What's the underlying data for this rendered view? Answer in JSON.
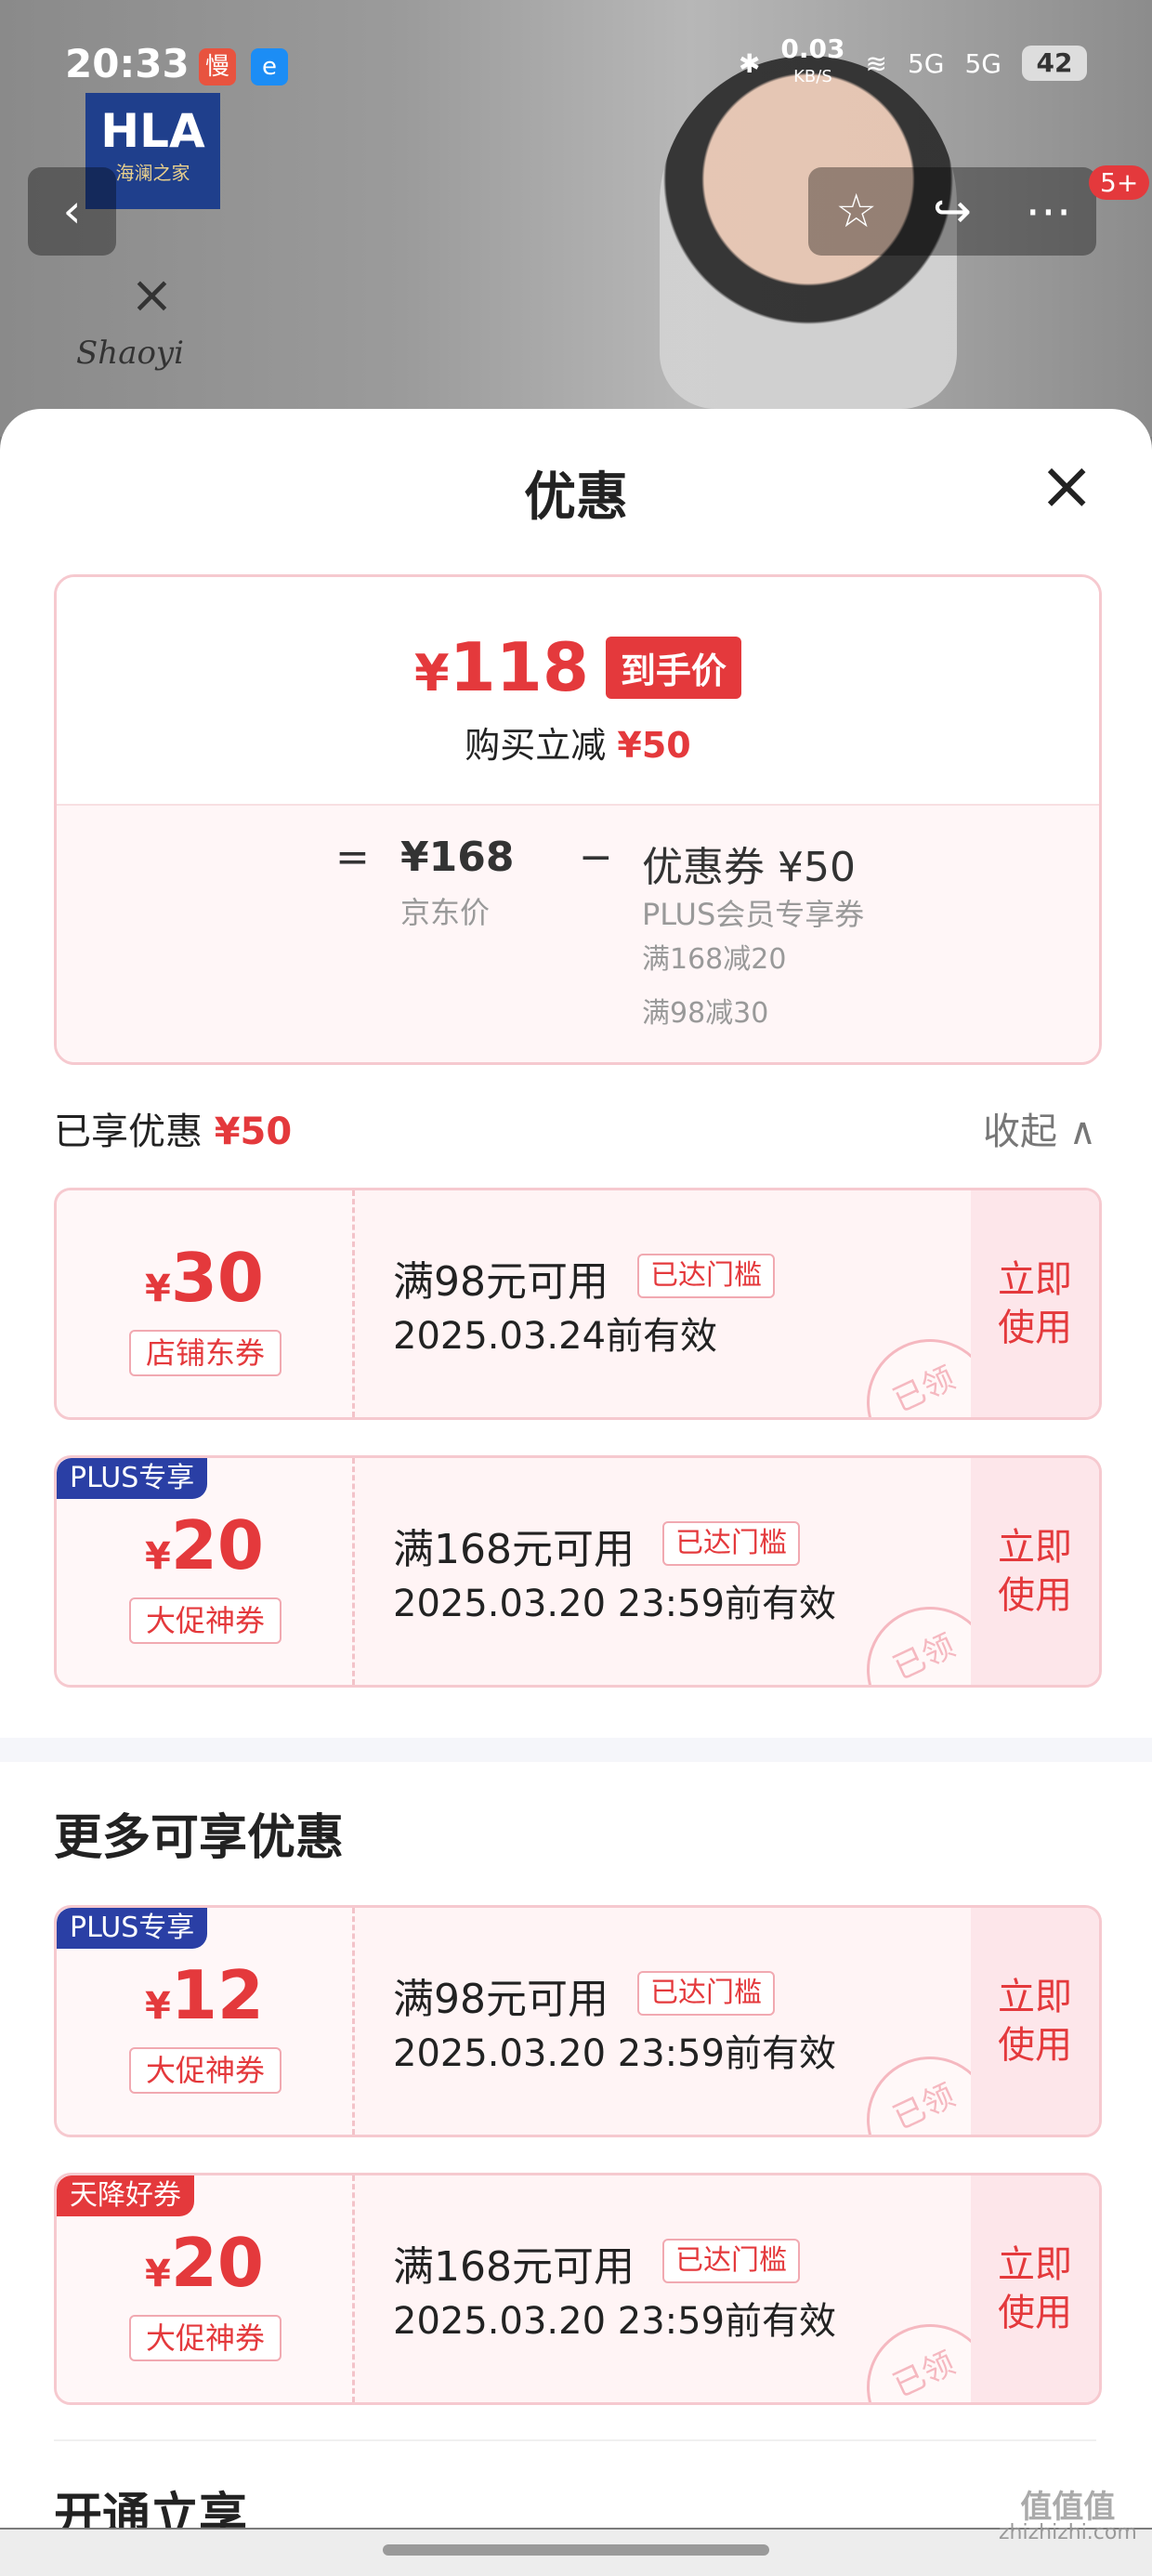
{
  "status": {
    "time": "20:33",
    "app1": "慢",
    "app2": "e",
    "net_speed": "0.03",
    "net_unit": "KB/S",
    "signal1": "5G",
    "signal2": "5G",
    "battery": "42"
  },
  "banner": {
    "logo_text": "HLA",
    "logo_subtext": "海澜之家",
    "cross": "×",
    "signature": "Shaoyi",
    "badge": "5+"
  },
  "sheet": {
    "title": "优惠",
    "close": "×"
  },
  "summary": {
    "price": "118",
    "yen": "¥",
    "tag": "到手价",
    "reduce_label": "购买立减",
    "reduce_value": "¥50",
    "eq": "=",
    "base_price": "¥168",
    "base_label": "京东价",
    "minus": "−",
    "coupon_label": "优惠券 ¥50",
    "coupon_sub": "PLUS会员专享券",
    "rule1": "满168减20",
    "rule2": "满98减30"
  },
  "enjoyed": {
    "label": "已享优惠",
    "value": "¥50",
    "collapse": "收起 ∧"
  },
  "coupons_enjoyed": [
    {
      "amount": "30",
      "type": "店铺东券",
      "condition": "满98元可用",
      "tag": "已达门槛",
      "valid": "2025.03.24前有效",
      "use": "立即 使用",
      "corner": "",
      "stamp": "已领"
    },
    {
      "amount": "20",
      "type": "大促神券",
      "condition": "满168元可用",
      "tag": "已达门槛",
      "valid": "2025.03.20 23:59前有效",
      "use": "立即 使用",
      "corner": "PLUS专享",
      "stamp": "已领"
    }
  ],
  "more_title": "更多可享优惠",
  "coupons_more": [
    {
      "amount": "12",
      "type": "大促神券",
      "condition": "满98元可用",
      "tag": "已达门槛",
      "valid": "2025.03.20 23:59前有效",
      "use": "立即 使用",
      "corner": "PLUS专享",
      "stamp": "已领"
    },
    {
      "amount": "20",
      "type": "大促神券",
      "condition": "满168元可用",
      "tag": "已达门槛",
      "valid": "2025.03.20 23:59前有效",
      "use": "立即 使用",
      "corner": "天降好券",
      "stamp": "已领"
    }
  ],
  "cut_section": "开通立享",
  "watermark": {
    "line1": "值值值",
    "line2": "zhizhizhi.com"
  }
}
